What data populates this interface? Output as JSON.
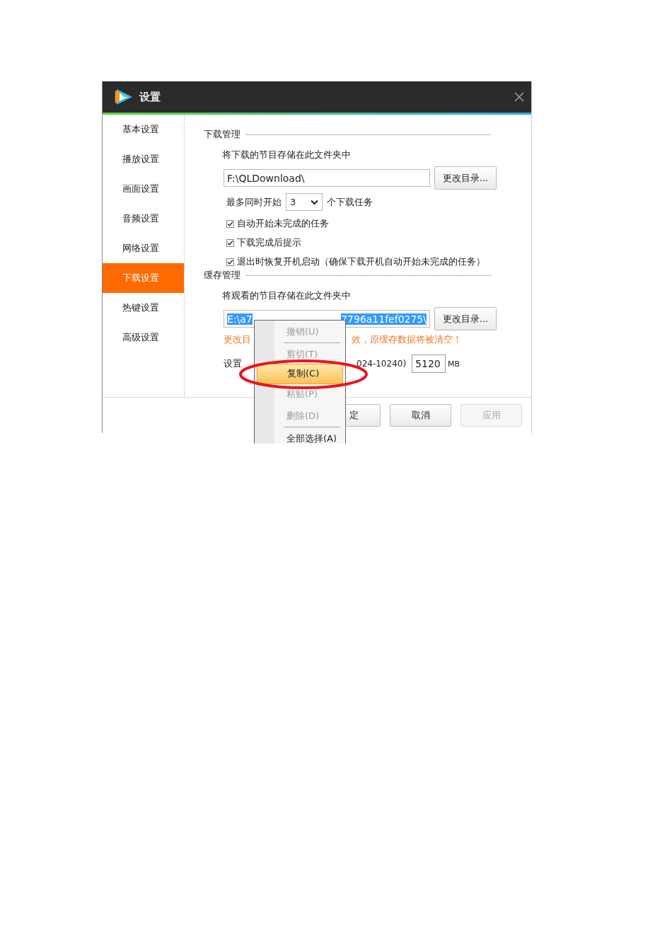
{
  "window": {
    "title": "设置"
  },
  "sidebar": {
    "items": [
      {
        "label": "基本设置",
        "selected": false
      },
      {
        "label": "播放设置",
        "selected": false
      },
      {
        "label": "画面设置",
        "selected": false
      },
      {
        "label": "音频设置",
        "selected": false
      },
      {
        "label": "网络设置",
        "selected": false
      },
      {
        "label": "下载设置",
        "selected": true
      },
      {
        "label": "热键设置",
        "selected": false
      },
      {
        "label": "高级设置",
        "selected": false
      }
    ]
  },
  "download": {
    "title": "下载管理",
    "folder_label": "将下载的节目存储在此文件夹中",
    "folder_value": "F:\\QLDownload\\",
    "change_button": "更改目录...",
    "max_prefix": "最多同时开始",
    "max_value": "3",
    "max_suffix": "个下载任务",
    "options": [
      {
        "label": "自动开始未完成的任务",
        "checked": true
      },
      {
        "label": "下载完成后提示",
        "checked": true
      },
      {
        "label": "退出时恢复开机启动（确保下载开机自动开始未完成的任务）",
        "checked": true
      }
    ]
  },
  "cache": {
    "title": "缓存管理",
    "folder_label": "将观看的节目存储在此文件夹中",
    "folder_value_start": "E:\\a7",
    "folder_value_end": "7796a11fef0275\\",
    "text_selected": true,
    "change_button": "更改目录...",
    "warning_start": "更改目",
    "warning_end": "效，原缓存数据将被清空！",
    "size_prefix": "设置",
    "size_range": "024-10240)",
    "size_value": "5120",
    "size_unit": "MB"
  },
  "buttons": [
    {
      "label": "定",
      "disabled": false
    },
    {
      "label": "取消",
      "disabled": false
    },
    {
      "label": "应用",
      "disabled": true
    }
  ],
  "context_menu": {
    "items": [
      {
        "kind": "item",
        "label": "撤销(U)",
        "disabled": true,
        "selected": false
      },
      {
        "kind": "separator"
      },
      {
        "kind": "item",
        "label": "剪切(T)",
        "disabled": true,
        "selected": false
      },
      {
        "kind": "item",
        "label": "复制(C)",
        "disabled": false,
        "selected": true
      },
      {
        "kind": "item",
        "label": "粘贴(P)",
        "disabled": true,
        "selected": false
      },
      {
        "kind": "item",
        "label": "删除(D)",
        "disabled": true,
        "selected": false
      },
      {
        "kind": "separator"
      },
      {
        "kind": "item",
        "label": "全部选择(A)",
        "disabled": false,
        "selected": false
      }
    ]
  },
  "annotation": {
    "kind": "ellipse"
  }
}
